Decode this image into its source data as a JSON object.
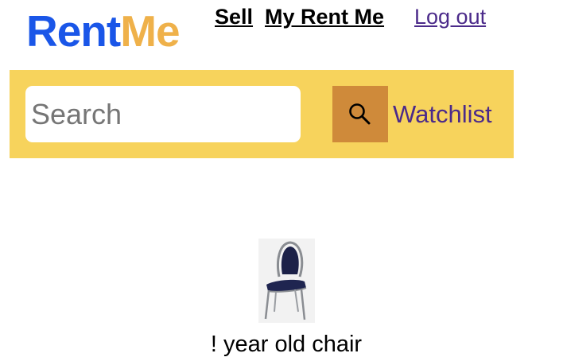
{
  "logo": {
    "part1": "Rent",
    "part2": "Me"
  },
  "nav": {
    "sell": "Sell",
    "my_rent_me": "My Rent Me",
    "logout": "Log out"
  },
  "search": {
    "placeholder": "Search",
    "value": "",
    "button_icon": "search-icon",
    "watchlist": "Watchlist"
  },
  "listings": [
    {
      "title": "! year old chair",
      "image_icon": "chair-image"
    }
  ],
  "colors": {
    "logo_rent": "#1a56e8",
    "logo_me": "#efb14a",
    "search_bar_bg": "#f7d35c",
    "search_button_bg": "#cf8a3a",
    "link_purple": "#4b2a8a"
  }
}
